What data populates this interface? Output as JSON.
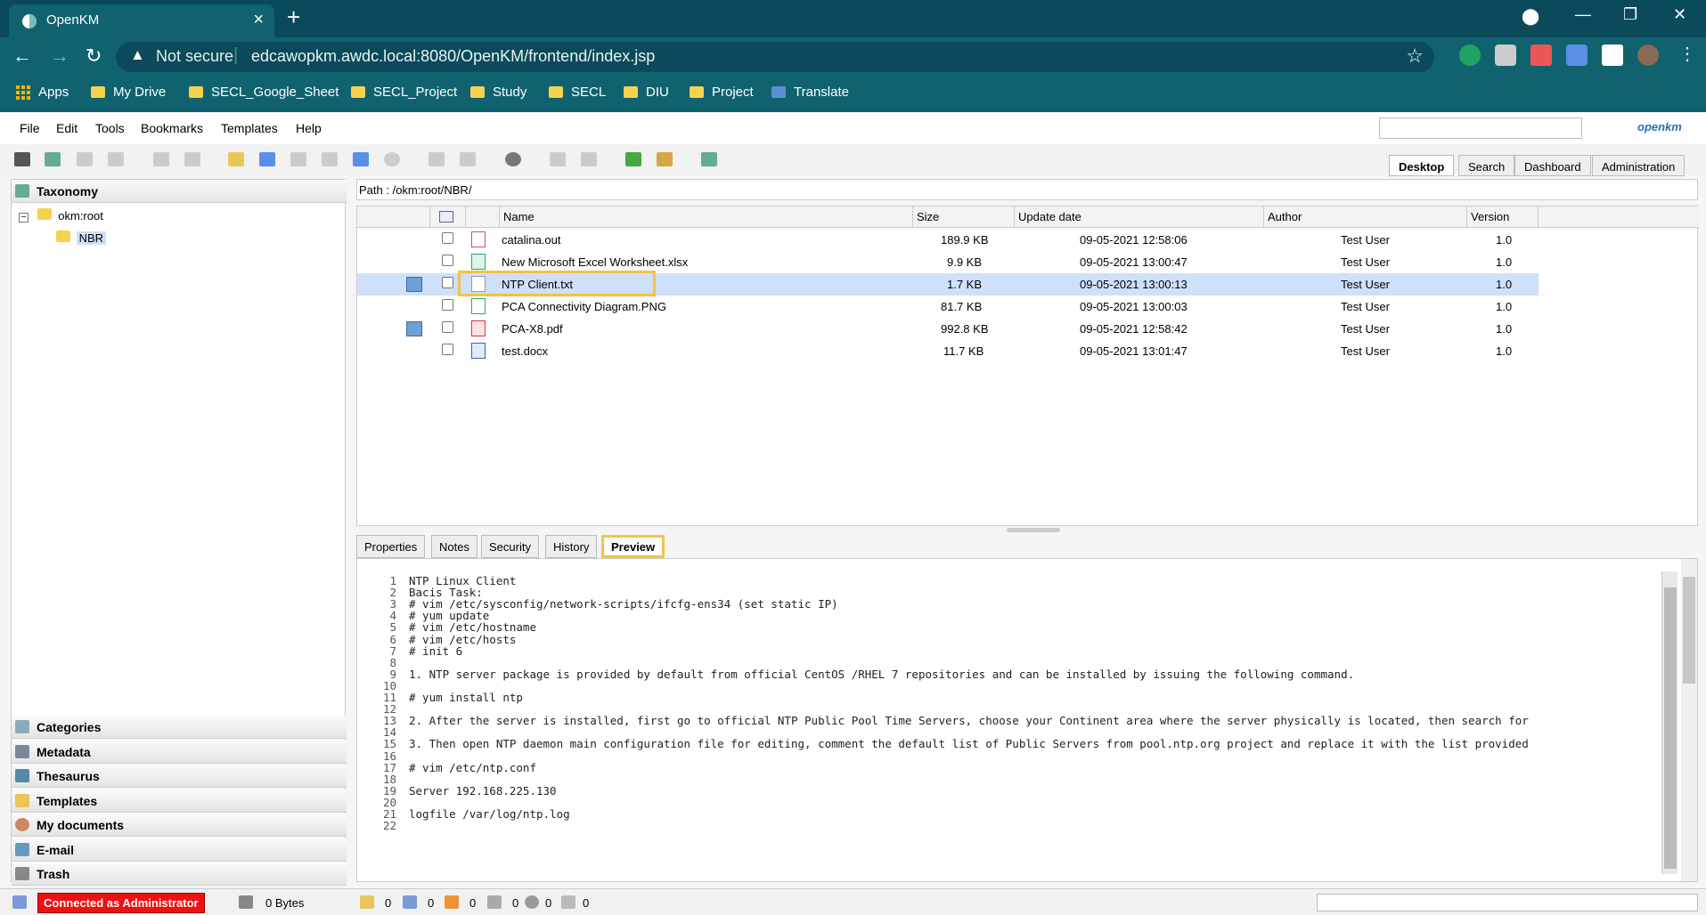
{
  "browser": {
    "tab_title": "OpenKM",
    "new_tab": "+",
    "security": "Not secure",
    "url": "edcawopkm.awdc.local:8080/OpenKM/frontend/index.jsp",
    "bookmarks": [
      "Apps",
      "My Drive",
      "SECL_Google_Sheet",
      "SECL_Project",
      "Study",
      "SECL",
      "DIU",
      "Project",
      "Translate"
    ]
  },
  "menu": [
    "File",
    "Edit",
    "Tools",
    "Bookmarks",
    "Templates",
    "Help"
  ],
  "logo": "openkm",
  "main_tabs": [
    "Desktop",
    "Search",
    "Dashboard",
    "Administration"
  ],
  "left": {
    "taxonomy": "Taxonomy",
    "root": "okm:root",
    "folder": "NBR",
    "stacks": [
      "Categories",
      "Metadata",
      "Thesaurus",
      "Templates",
      "My documents",
      "E-mail",
      "Trash"
    ]
  },
  "path": "Path : /okm:root/NBR/",
  "grid": {
    "columns": [
      "Name",
      "Size",
      "Update date",
      "Author",
      "Version"
    ],
    "rows": [
      {
        "name": "catalina.out",
        "size": "189.9 KB",
        "date": "09-05-2021 12:58:06",
        "author": "Test User",
        "version": "1.0"
      },
      {
        "name": "New Microsoft Excel Worksheet.xlsx",
        "size": "9.9 KB",
        "date": "09-05-2021 13:00:47",
        "author": "Test User",
        "version": "1.0"
      },
      {
        "name": "NTP Client.txt",
        "size": "1.7 KB",
        "date": "09-05-2021 13:00:13",
        "author": "Test User",
        "version": "1.0"
      },
      {
        "name": "PCA Connectivity Diagram.PNG",
        "size": "81.7 KB",
        "date": "09-05-2021 13:00:03",
        "author": "Test User",
        "version": "1.0"
      },
      {
        "name": "PCA-X8.pdf",
        "size": "992.8 KB",
        "date": "09-05-2021 12:58:42",
        "author": "Test User",
        "version": "1.0"
      },
      {
        "name": "test.docx",
        "size": "11.7 KB",
        "date": "09-05-2021 13:01:47",
        "author": "Test User",
        "version": "1.0"
      }
    ]
  },
  "bottom_tabs": [
    "Properties",
    "Notes",
    "Security",
    "History",
    "Preview"
  ],
  "preview_lines": [
    "NTP Linux Client",
    "Bacis Task:",
    "# vim /etc/sysconfig/network-scripts/ifcfg-ens34 (set static IP)",
    "# yum update",
    "# vim /etc/hostname",
    "# vim /etc/hosts",
    "# init 6",
    "",
    "1. NTP server package is provided by default from official CentOS /RHEL 7 repositories and can be installed by issuing the following command.",
    "",
    "# yum install ntp",
    "",
    "2. After the server is installed, first go to official NTP Public Pool Time Servers, choose your Continent area where the server physically is located, then search for",
    "",
    "3. Then open NTP daemon main configuration file for editing, comment the default list of Public Servers from pool.ntp.org project and replace it with the list provided",
    "",
    "# vim /etc/ntp.conf",
    "",
    "Server 192.168.225.130",
    "",
    "logfile /var/log/ntp.log",
    ""
  ],
  "status": {
    "connected": "Connected as Administrator",
    "bytes": "0 Bytes",
    "counts": [
      "0",
      "0",
      "0",
      "0",
      "0",
      "0"
    ]
  }
}
